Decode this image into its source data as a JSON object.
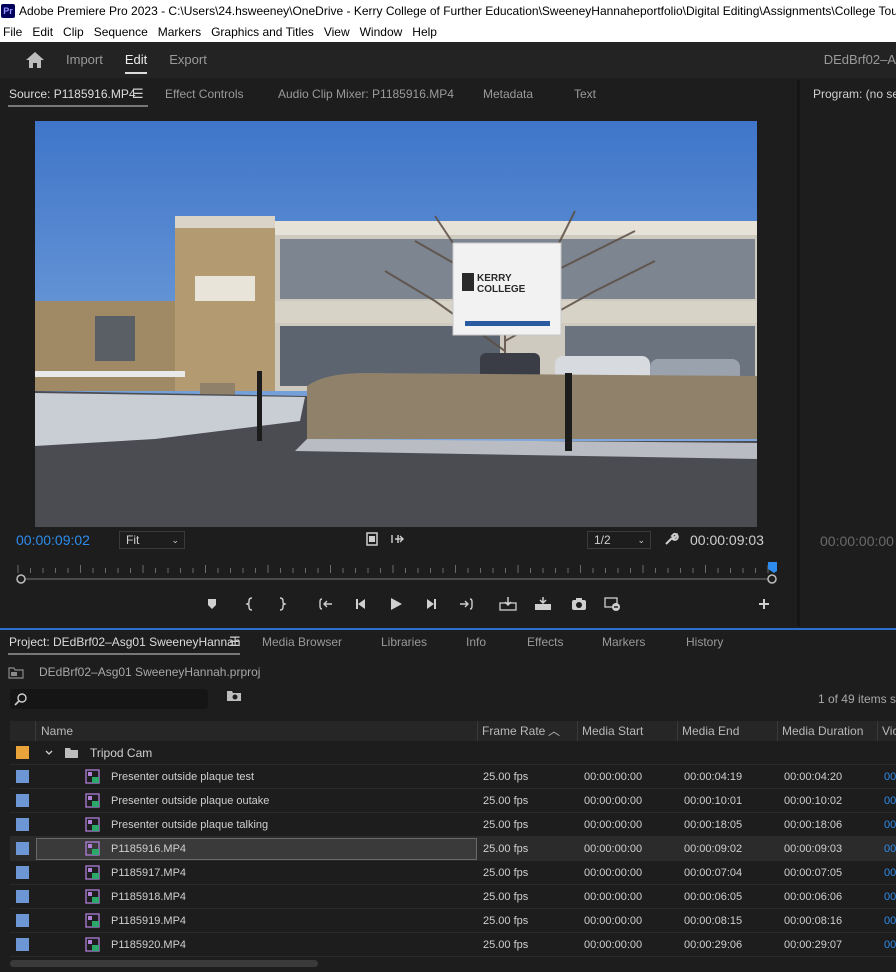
{
  "title_bar": {
    "app_logo": "Pr",
    "title": "Adobe Premiere Pro 2023 - C:\\Users\\24.hsweeney\\OneDrive - Kerry College of Further Education\\SweeneyHannaheportfolio\\Digital Editing\\Assignments\\College Tour"
  },
  "menu": [
    "File",
    "Edit",
    "Clip",
    "Sequence",
    "Markers",
    "Graphics and Titles",
    "View",
    "Window",
    "Help"
  ],
  "workspace": {
    "home_icon": "home-icon",
    "tabs": [
      {
        "label": "Import",
        "active": false
      },
      {
        "label": "Edit",
        "active": true
      },
      {
        "label": "Export",
        "active": false
      }
    ],
    "project_name": "DEdBrf02–A"
  },
  "source_monitor": {
    "tabs": [
      {
        "label": "Source: P1185916.MP4",
        "active": true
      },
      {
        "label": "Effect Controls",
        "active": false
      },
      {
        "label": "Audio Clip Mixer: P1185916.MP4",
        "active": false
      },
      {
        "label": "Metadata",
        "active": false
      },
      {
        "label": "Text",
        "active": false
      }
    ],
    "current_time": "00:00:09:02",
    "zoom": "Fit",
    "resolution": "1/2",
    "duration": "00:00:09:03",
    "playhead_position": 1.0,
    "sign_text": {
      "line1": "KERRY",
      "line2": "COLLEGE"
    },
    "transport_icons": [
      "add-marker-icon",
      "mark-in-icon",
      "mark-out-icon",
      "go-to-in-icon",
      "step-back-icon",
      "play-icon",
      "step-forward-icon",
      "go-to-out-icon",
      "insert-icon",
      "overwrite-icon",
      "export-frame-icon",
      "swap-icon",
      "add-button-icon"
    ]
  },
  "program_monitor": {
    "title": "Program: (no sec",
    "time": "00:00:00:00"
  },
  "project_panel": {
    "tabs": [
      {
        "label": "Project: DEdBrf02–Asg01 SweeneyHannah",
        "active": true
      },
      {
        "label": "Media Browser",
        "active": false
      },
      {
        "label": "Libraries",
        "active": false
      },
      {
        "label": "Info",
        "active": false
      },
      {
        "label": "Effects",
        "active": false
      },
      {
        "label": "Markers",
        "active": false
      },
      {
        "label": "History",
        "active": false
      }
    ],
    "project_file": "DEdBrf02–Asg01 SweeneyHannah.prproj",
    "search_placeholder": "",
    "items_count": "1 of 49 items s",
    "columns": [
      "Name",
      "Frame Rate",
      "Media Start",
      "Media End",
      "Media Duration",
      "Vic"
    ],
    "sort_column": "Frame Rate",
    "folder": {
      "name": "Tripod Cam",
      "color": "#e8a43a"
    },
    "clips": [
      {
        "name": "Presenter outside plaque test",
        "frame_rate": "25.00 fps",
        "media_start": "00:00:00:00",
        "media_end": "00:00:04:19",
        "media_duration": "00:00:04:20",
        "video": "00",
        "selected": false
      },
      {
        "name": "Presenter outside plaque outake",
        "frame_rate": "25.00 fps",
        "media_start": "00:00:00:00",
        "media_end": "00:00:10:01",
        "media_duration": "00:00:10:02",
        "video": "00",
        "selected": false
      },
      {
        "name": "Presenter outside plaque talking",
        "frame_rate": "25.00 fps",
        "media_start": "00:00:00:00",
        "media_end": "00:00:18:05",
        "media_duration": "00:00:18:06",
        "video": "00",
        "selected": false
      },
      {
        "name": "P1185916.MP4",
        "frame_rate": "25.00 fps",
        "media_start": "00:00:00:00",
        "media_end": "00:00:09:02",
        "media_duration": "00:00:09:03",
        "video": "00",
        "selected": true
      },
      {
        "name": "P1185917.MP4",
        "frame_rate": "25.00 fps",
        "media_start": "00:00:00:00",
        "media_end": "00:00:07:04",
        "media_duration": "00:00:07:05",
        "video": "00",
        "selected": false
      },
      {
        "name": "P1185918.MP4",
        "frame_rate": "25.00 fps",
        "media_start": "00:00:00:00",
        "media_end": "00:00:06:05",
        "media_duration": "00:00:06:06",
        "video": "00",
        "selected": false
      },
      {
        "name": "P1185919.MP4",
        "frame_rate": "25.00 fps",
        "media_start": "00:00:00:00",
        "media_end": "00:00:08:15",
        "media_duration": "00:00:08:16",
        "video": "00",
        "selected": false
      },
      {
        "name": "P1185920.MP4",
        "frame_rate": "25.00 fps",
        "media_start": "00:00:00:00",
        "media_end": "00:00:29:06",
        "media_duration": "00:00:29:07",
        "video": "00",
        "selected": false
      }
    ]
  },
  "colors": {
    "accent_blue": "#2d8ceb",
    "clip_label": "#6c96d4",
    "folder_label": "#e8a43a"
  }
}
